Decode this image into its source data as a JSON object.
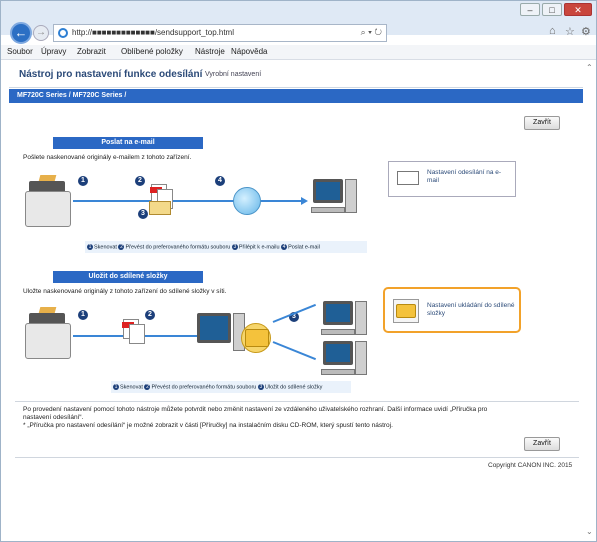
{
  "browser": {
    "url": "http://■■■■■■■■■■■■■/sendsupport_top.html",
    "address_tools": "⌕ ▾ ↻",
    "home_icon": "⌂",
    "star_icon": "☆",
    "gear_icon": "⚙",
    "min_label": "–",
    "max_label": "□",
    "close_label": "✕"
  },
  "menu": {
    "items": [
      "Soubor",
      "Úpravy",
      "Zobrazit",
      "Oblíbené položky",
      "Nástroje",
      "Nápověda"
    ]
  },
  "page": {
    "title": "Nástroj pro nastavení funkce odesílání",
    "link": "Vyrobní nastavení",
    "model_bar": "MF720C Series / MF720C Series /",
    "close_label": "Zavřít",
    "close_label_bottom": "Zavřít",
    "copyright": "Copyright CANON INC. 2015"
  },
  "email_section": {
    "heading": "Poslat na e-mail",
    "description": "Pošlete naskenované originály e-mailem z tohoto zařízení.",
    "steps": [
      "1",
      "2",
      "3",
      "4"
    ],
    "legend": [
      {
        "n": "1",
        "text": "Skenovat"
      },
      {
        "n": "2",
        "text": "Převést do preferovaného formátu souboru"
      },
      {
        "n": "3",
        "text": "Přilépit k e-mailu"
      },
      {
        "n": "4",
        "text": "Poslat e-mail"
      }
    ],
    "card_label": "Nastavení odesílání na e-mail"
  },
  "folder_section": {
    "heading": "Uložit do sdílené složky",
    "description": "Uložte naskenované originály z tohoto zařízení do sdílené složky v síti.",
    "steps": [
      "1",
      "2",
      "3"
    ],
    "legend": [
      {
        "n": "1",
        "text": "Skenovat"
      },
      {
        "n": "2",
        "text": "Převést do preferovaného formátu souboru"
      },
      {
        "n": "3",
        "text": "Uložit do sdílené složky"
      }
    ],
    "card_label": "Nastavení ukládání do sdílené složky"
  },
  "footnote": {
    "line1": "Po provedení nastavení pomocí tohoto nástroje můžete potvrdit nebo změnit nastavení ze vzdáleného uživatelského rozhraní. Další informace uvidí „Příručka pro",
    "line2": "nastavení odesílání“.",
    "line3": "* „Příručka pro nastavení odesílání“ je možné zobrazit v části [Příručky] na instalačním disku CD-ROM, který spustí tento nástroj."
  },
  "colors": {
    "accent": "#2b68c4",
    "highlight": "#f2a22a",
    "flow": "#3a86d6"
  }
}
